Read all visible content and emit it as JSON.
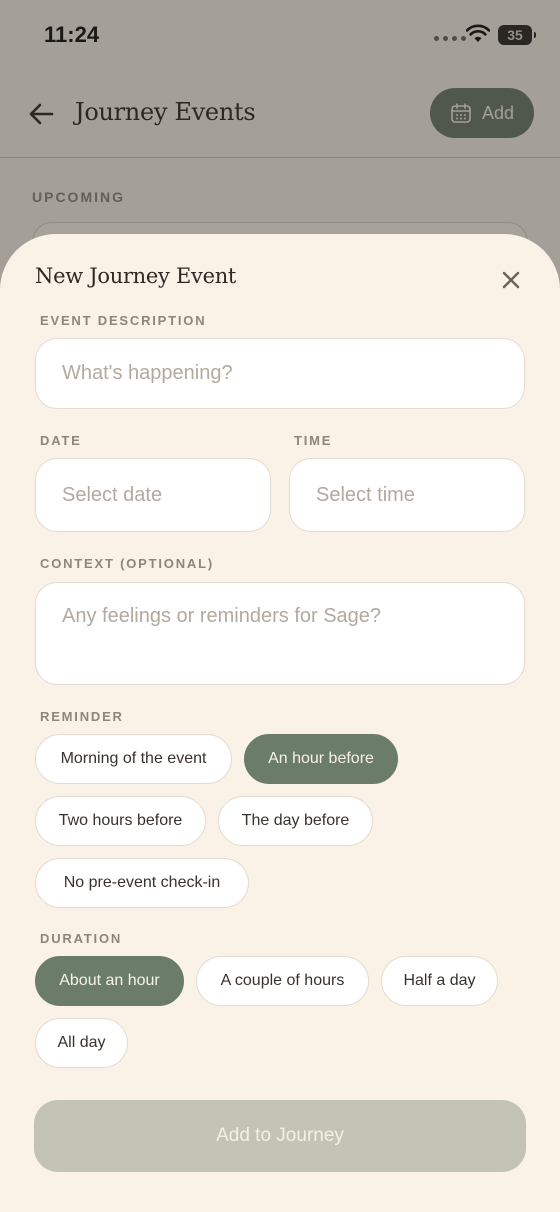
{
  "status_bar": {
    "time": "11:24",
    "battery": "35"
  },
  "nav": {
    "title": "Journey Events",
    "add_label": "Add"
  },
  "background": {
    "section_label": "UPCOMING"
  },
  "sheet": {
    "title": "New Journey Event",
    "description": {
      "label": "EVENT DESCRIPTION",
      "placeholder": "What's happening?"
    },
    "date": {
      "label": "DATE",
      "placeholder": "Select date"
    },
    "time": {
      "label": "TIME",
      "placeholder": "Select time"
    },
    "context": {
      "label": "CONTEXT (OPTIONAL)",
      "placeholder": "Any feelings or reminders for Sage?"
    },
    "reminder": {
      "label": "REMINDER",
      "options": [
        "Morning of the event",
        "An hour before",
        "Two hours before",
        "The day before",
        "No pre-event check-in"
      ],
      "selected": "An hour before"
    },
    "duration": {
      "label": "DURATION",
      "options": [
        "About an hour",
        "A couple of hours",
        "Half a day",
        "All day"
      ],
      "selected": "About an hour"
    },
    "submit_label": "Add to Journey"
  },
  "colors": {
    "accent": "#6b7c6b",
    "sheet_bg": "#faf2e6",
    "submit_disabled": "#c3c4b4"
  }
}
